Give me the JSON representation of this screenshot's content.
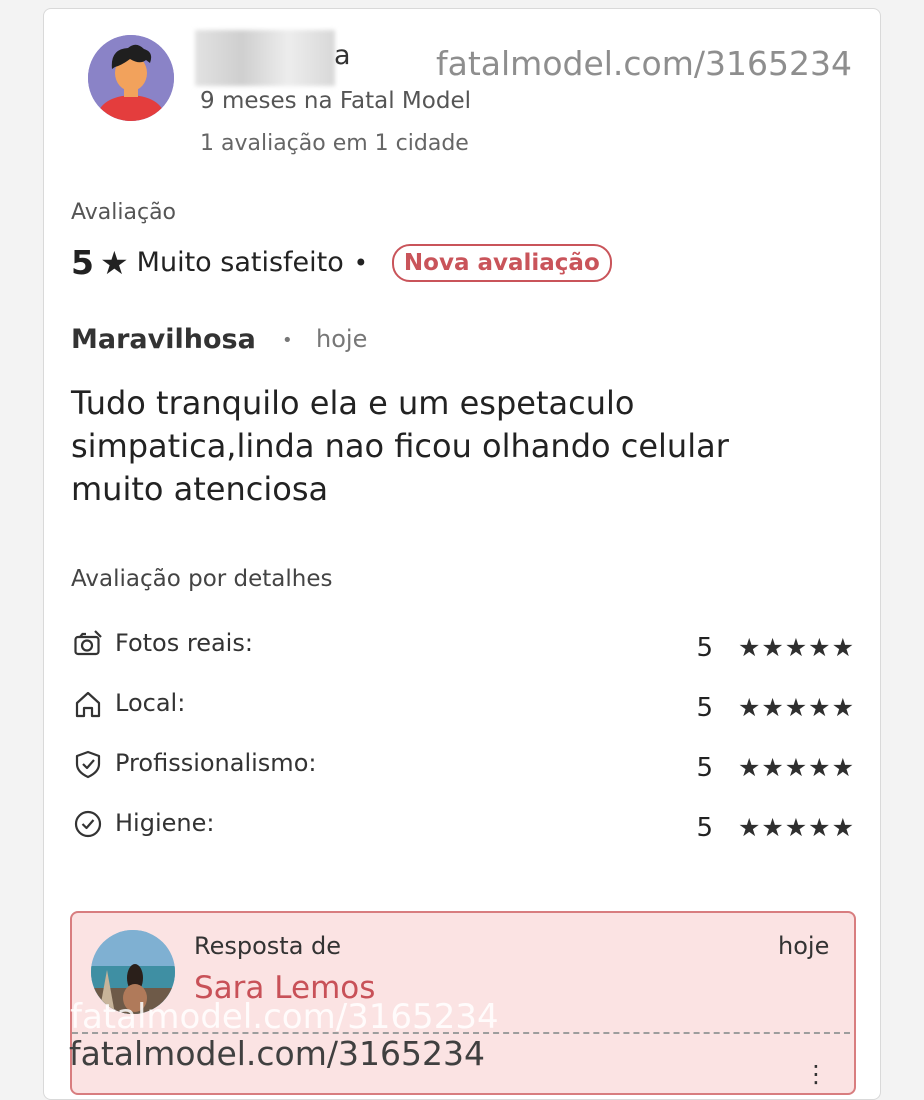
{
  "header": {
    "username_suffix": "a",
    "member_since": "9 meses na Fatal Model",
    "reviews_count": "1 avaliação em 1 cidade",
    "watermark": "fatalmodel.com/3165234"
  },
  "rating": {
    "label": "Avaliação",
    "score": "5",
    "star": "★",
    "description": "Muito satisfeito",
    "separator": "•",
    "badge": "Nova avaliação"
  },
  "review": {
    "title": "Maravilhosa",
    "separator": "•",
    "date": "hoje",
    "body": "Tudo tranquilo ela e um espetaculo simpatica,linda nao ficou olhando celular muito atenciosa"
  },
  "details": {
    "title": "Avaliação por detalhes",
    "items": [
      {
        "label": "Fotos reais:",
        "score": "5",
        "stars": "★★★★★",
        "icon": "camera-icon"
      },
      {
        "label": "Local:",
        "score": "5",
        "stars": "★★★★★",
        "icon": "home-icon"
      },
      {
        "label": "Profissionalismo:",
        "score": "5",
        "stars": "★★★★★",
        "icon": "shield-check-icon"
      },
      {
        "label": "Higiene:",
        "score": "5",
        "stars": "★★★★★",
        "icon": "check-circle-icon"
      }
    ]
  },
  "reply": {
    "from_label": "Resposta de",
    "name": "Sara Lemos",
    "date": "hoje",
    "watermark_ghost": "fatalmodel.com/3165234",
    "watermark": "fatalmodel.com/3165234",
    "menu": "⋮"
  },
  "colors": {
    "accent": "#c9545a",
    "reply_background": "#fbe3e3",
    "reply_border": "#d87d7f"
  }
}
